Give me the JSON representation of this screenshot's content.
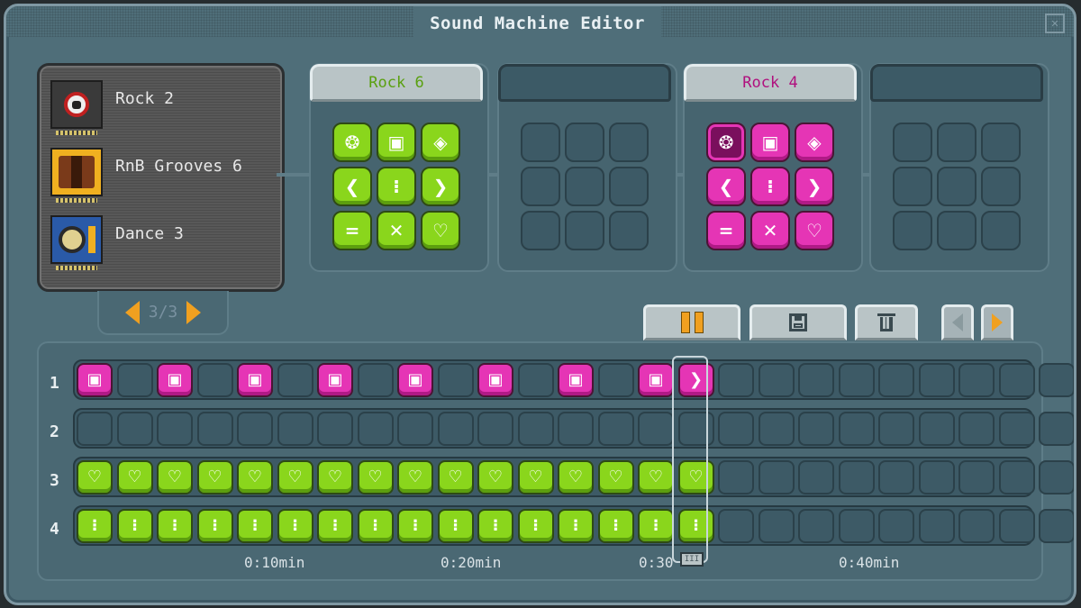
{
  "window": {
    "title": "Sound Machine Editor",
    "close_glyph": "✕"
  },
  "library": {
    "items": [
      {
        "label": "Rock 2",
        "icon": "skull-record-icon",
        "color": "#3a3a3a"
      },
      {
        "label": "RnB Grooves 6",
        "icon": "curtain-record-icon",
        "color": "#f0b020"
      },
      {
        "label": "Dance 3",
        "icon": "speaker-record-icon",
        "color": "#2a5aa8"
      }
    ],
    "pager": "3/3"
  },
  "slots": [
    {
      "title": "Rock 6",
      "color": "green",
      "title_color": "#5aa010",
      "glyphs": [
        "❂",
        "▣",
        "◈",
        "❮",
        "⁝",
        "❯",
        "=",
        "✕",
        "♡"
      ]
    },
    {
      "title": "",
      "color": "empty",
      "glyphs": []
    },
    {
      "title": "Rock 4",
      "color": "pink",
      "title_color": "#b0107e",
      "glyphs": [
        "❂",
        "▣",
        "◈",
        "❮",
        "⁝",
        "❯",
        "=",
        "✕",
        "♡"
      ]
    },
    {
      "title": "",
      "color": "empty",
      "glyphs": []
    }
  ],
  "controls": {
    "pause_icon": "pause-icon",
    "save_icon": "save-icon",
    "delete_icon": "trash-icon",
    "accent": "#f0a020"
  },
  "tracks": [
    {
      "number": "1",
      "cells": [
        "P▣",
        "",
        "P▣",
        "",
        "P▣",
        "",
        "P▣",
        "",
        "P▣",
        "",
        "P▣",
        "",
        "P▣",
        "",
        "P▣",
        "P❯",
        "",
        "",
        "",
        "",
        "",
        "",
        "",
        "",
        ""
      ]
    },
    {
      "number": "2",
      "cells": [
        "",
        "",
        "",
        "",
        "",
        "",
        "",
        "",
        "",
        "",
        "",
        "",
        "",
        "",
        "",
        "",
        "",
        "",
        "",
        "",
        "",
        "",
        "",
        "",
        ""
      ]
    },
    {
      "number": "3",
      "cells": [
        "G♡",
        "G♡",
        "G♡",
        "G♡",
        "G♡",
        "G♡",
        "G♡",
        "G♡",
        "G♡",
        "G♡",
        "G♡",
        "G♡",
        "G♡",
        "G♡",
        "G♡",
        "G♡",
        "",
        "",
        "",
        "",
        "",
        "",
        "",
        "",
        ""
      ]
    },
    {
      "number": "4",
      "cells": [
        "G⁝",
        "G⁝",
        "G⁝",
        "G⁝",
        "G⁝",
        "G⁝",
        "G⁝",
        "G⁝",
        "G⁝",
        "G⁝",
        "G⁝",
        "G⁝",
        "G⁝",
        "G⁝",
        "G⁝",
        "G⁝",
        "",
        "",
        "",
        "",
        "",
        "",
        "",
        "",
        ""
      ]
    }
  ],
  "time_labels": [
    "0:10min",
    "0:20min",
    "0:30",
    "0:40min"
  ]
}
